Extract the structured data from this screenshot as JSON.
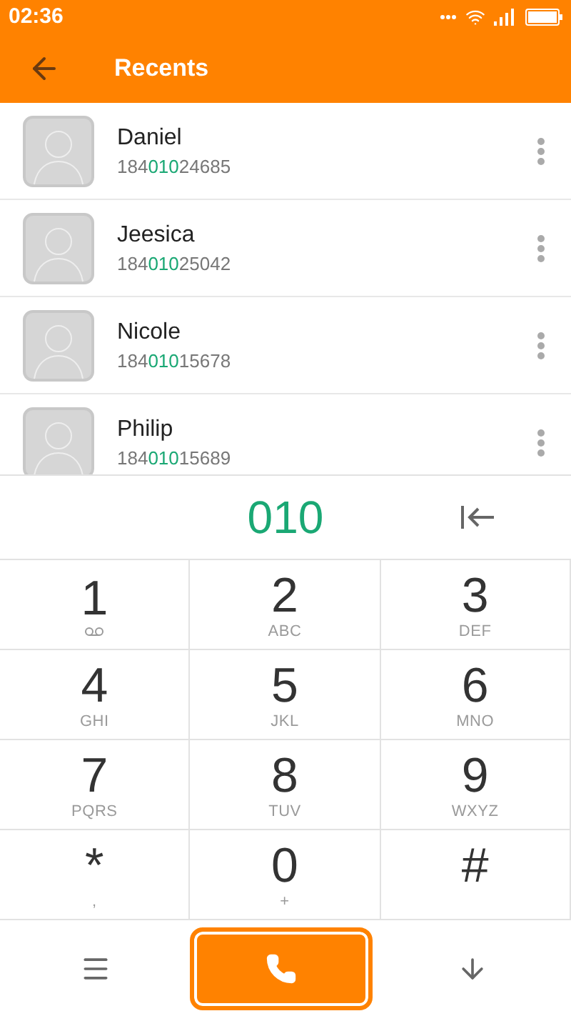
{
  "status_bar": {
    "time": "02:36"
  },
  "header": {
    "title": "Recents"
  },
  "contacts": [
    {
      "name": "Daniel",
      "number": {
        "before": "184",
        "match": "010",
        "after": "24685"
      }
    },
    {
      "name": "Jeesica",
      "number": {
        "before": "184",
        "match": "010",
        "after": "25042"
      }
    },
    {
      "name": "Nicole",
      "number": {
        "before": "184",
        "match": "010",
        "after": "15678"
      }
    },
    {
      "name": "Philip",
      "number": {
        "before": "184",
        "match": "010",
        "after": "15689"
      }
    }
  ],
  "dialed": "010",
  "keys": [
    {
      "kind": "voicemail",
      "digit": "1"
    },
    {
      "kind": "letters",
      "digit": "2",
      "sub": "ABC"
    },
    {
      "kind": "letters",
      "digit": "3",
      "sub": "DEF"
    },
    {
      "kind": "letters",
      "digit": "4",
      "sub": "GHI"
    },
    {
      "kind": "letters",
      "digit": "5",
      "sub": "JKL"
    },
    {
      "kind": "letters",
      "digit": "6",
      "sub": "MNO"
    },
    {
      "kind": "letters",
      "digit": "7",
      "sub": "PQRS"
    },
    {
      "kind": "letters",
      "digit": "8",
      "sub": "TUV"
    },
    {
      "kind": "letters",
      "digit": "9",
      "sub": "WXYZ"
    },
    {
      "kind": "letters",
      "digit": "*",
      "sub": ","
    },
    {
      "kind": "letters",
      "digit": "0",
      "sub": "+"
    },
    {
      "kind": "plain",
      "digit": "#"
    }
  ]
}
